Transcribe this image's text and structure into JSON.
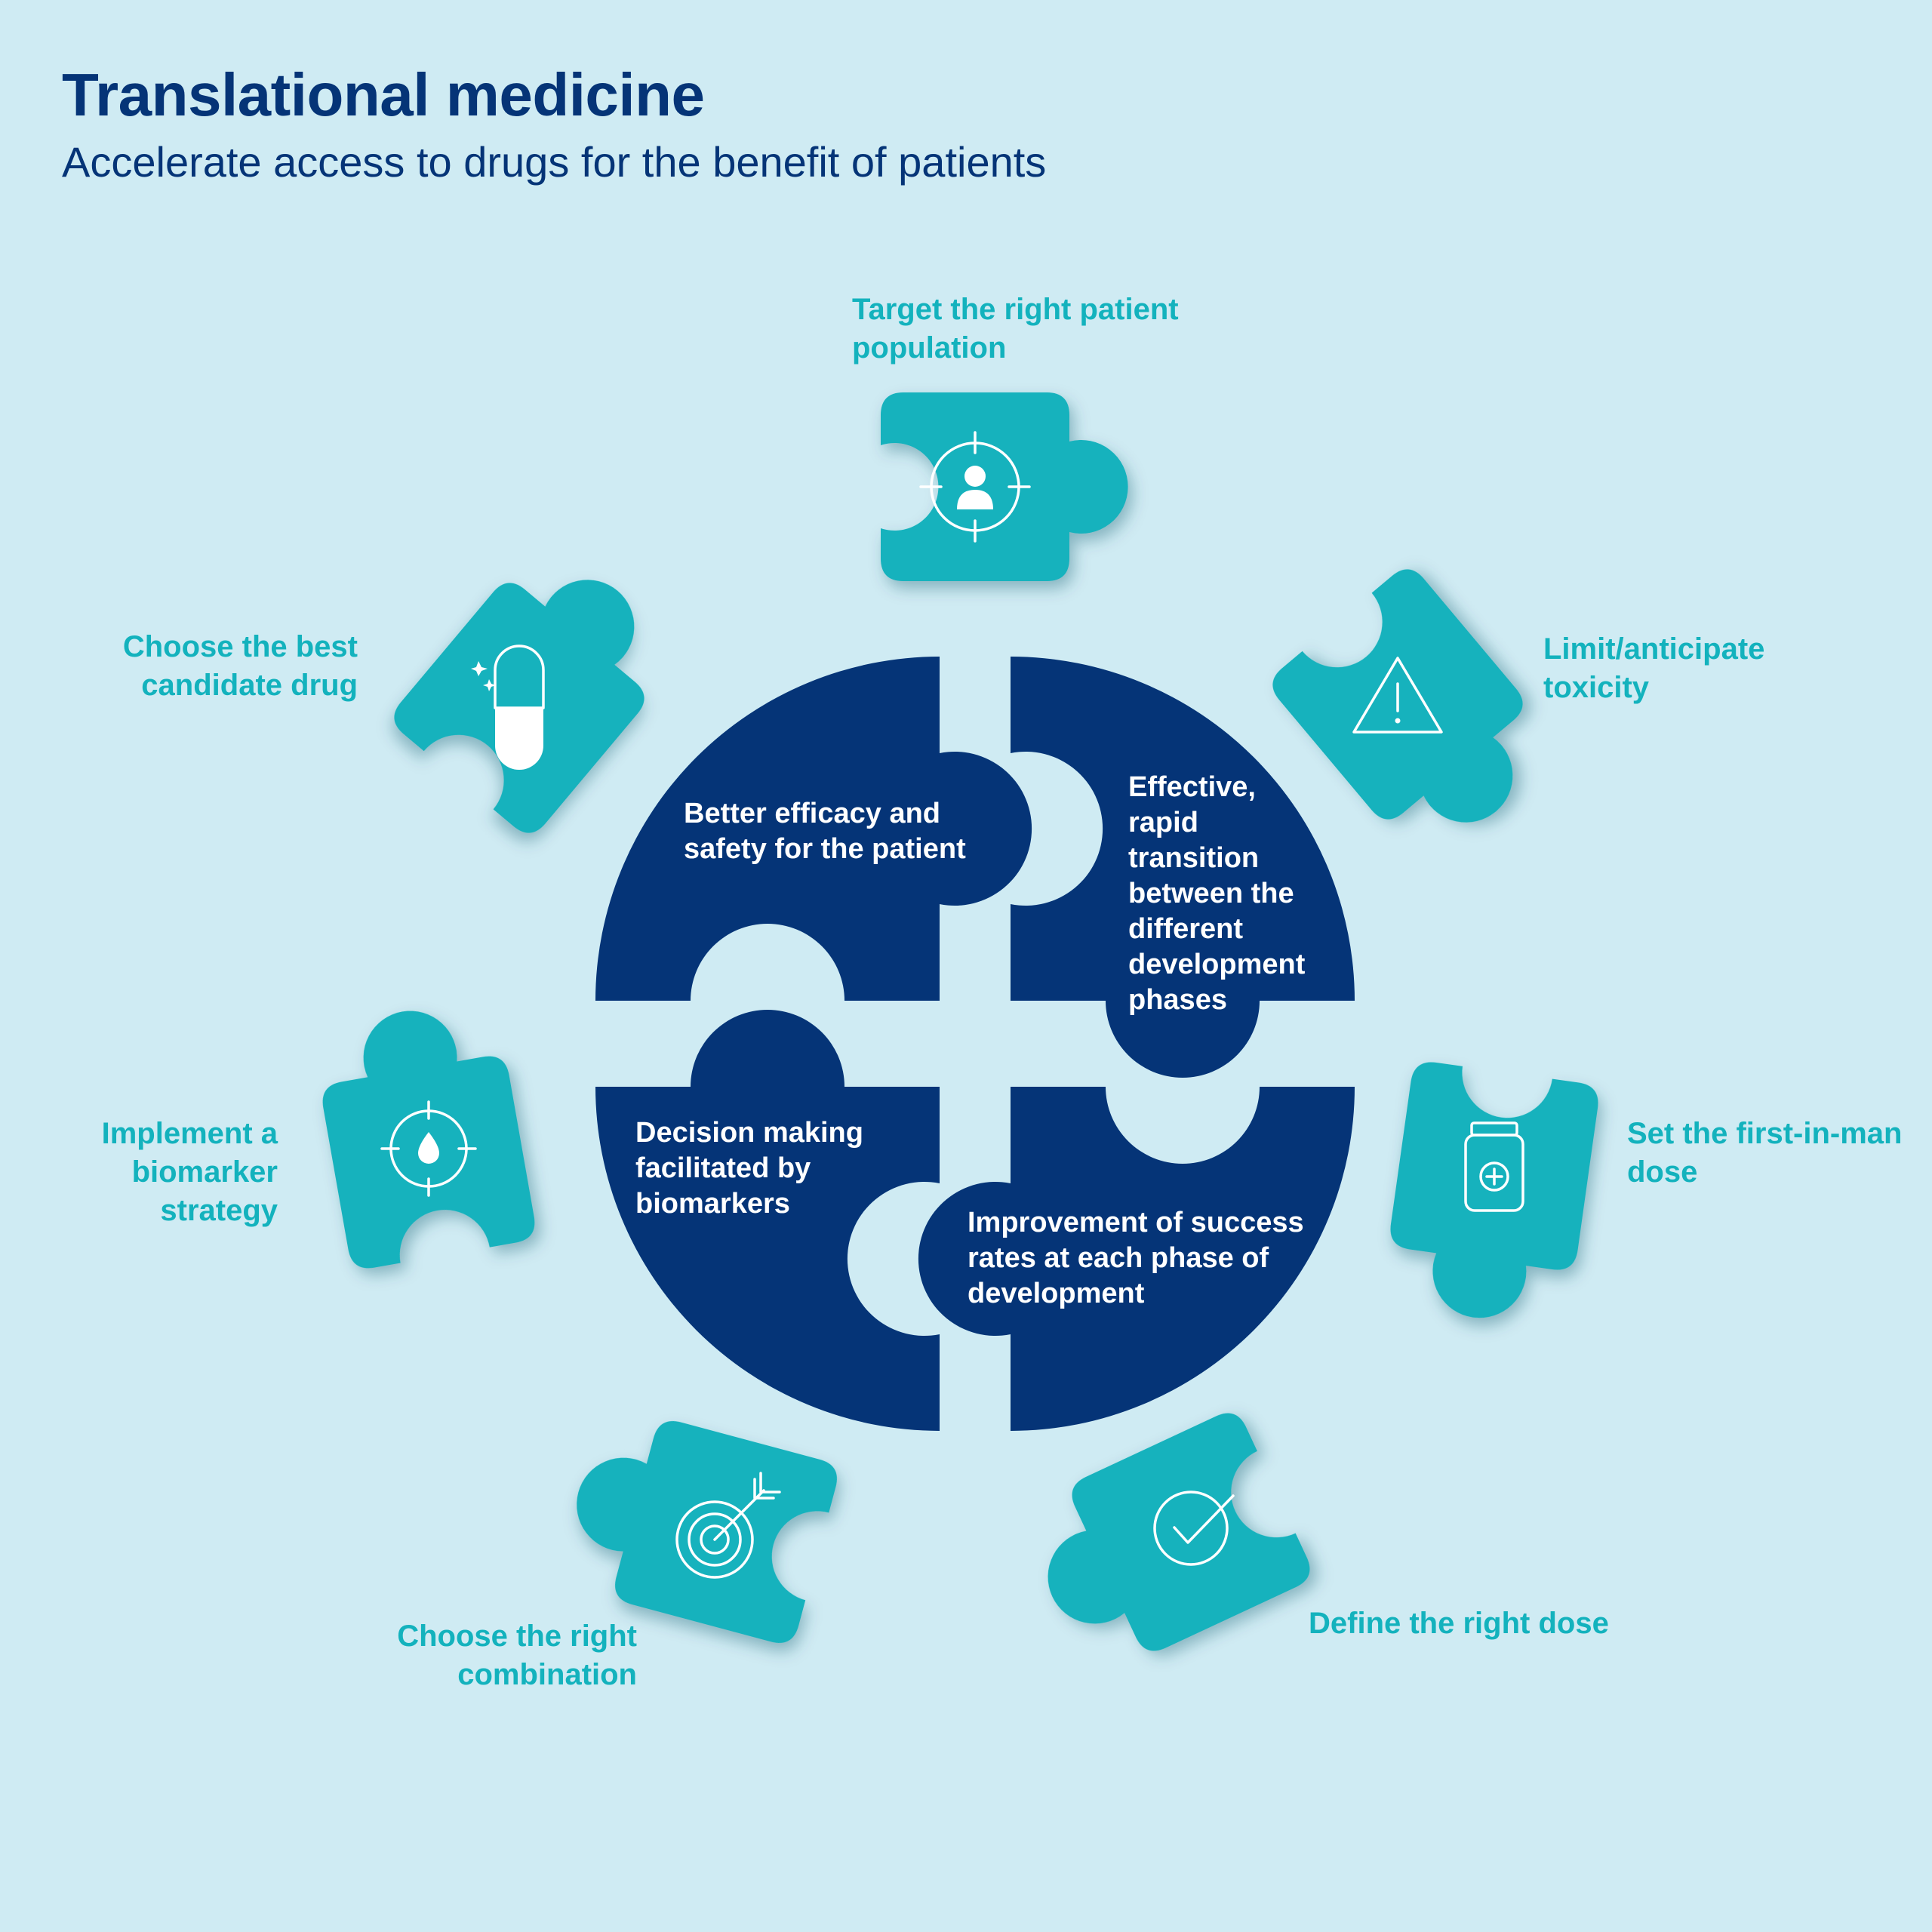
{
  "header": {
    "title": "Translational medicine",
    "subtitle": "Accelerate access to drugs for the benefit of patients"
  },
  "center": {
    "pieces": [
      {
        "id": "top-left",
        "lines": [
          "Better efficacy and",
          "safety for the patient"
        ]
      },
      {
        "id": "top-right",
        "lines": [
          "Effective,",
          "rapid",
          "transition",
          "between the",
          "different",
          "development",
          "phases"
        ]
      },
      {
        "id": "bottom-left",
        "lines": [
          "Decision making",
          "facilitated by",
          "biomarkers"
        ]
      },
      {
        "id": "bottom-right",
        "lines": [
          "Improvement of success",
          "rates at each phase of",
          "development"
        ]
      }
    ]
  },
  "outer": {
    "items": [
      {
        "id": "target-population",
        "icon": "target-person-icon",
        "lines": [
          "Target the right patient",
          "population"
        ]
      },
      {
        "id": "limit-toxicity",
        "icon": "warning-triangle-icon",
        "lines": [
          "Limit/anticipate",
          "toxicity"
        ]
      },
      {
        "id": "first-in-man-dose",
        "icon": "medicine-jar-icon",
        "lines": [
          "Set the first-in-man",
          "dose"
        ]
      },
      {
        "id": "right-dose",
        "icon": "checkmark-circle-icon",
        "lines": [
          "Define the right dose"
        ]
      },
      {
        "id": "right-combination",
        "icon": "dartboard-icon",
        "lines": [
          "Choose the right",
          "combination"
        ]
      },
      {
        "id": "biomarker-strategy",
        "icon": "target-drop-icon",
        "lines": [
          "Implement a",
          "biomarker",
          "strategy"
        ]
      },
      {
        "id": "candidate-drug",
        "icon": "capsule-icon",
        "lines": [
          "Choose the best",
          "candidate drug"
        ]
      }
    ]
  },
  "colors": {
    "background": "#cfebf3",
    "navy": "#053477",
    "teal": "#13b2bd",
    "caption": "#13b2bd"
  }
}
